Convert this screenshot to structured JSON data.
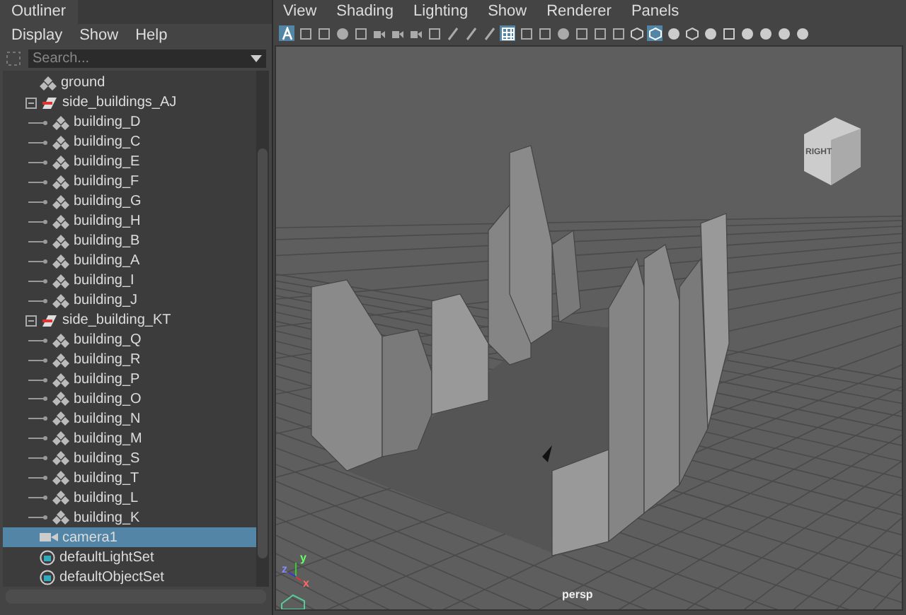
{
  "outliner": {
    "tab": "Outliner",
    "menu": [
      "Display",
      "Show",
      "Help"
    ],
    "search": {
      "placeholder": "Search..."
    },
    "items": [
      {
        "label": "ground",
        "kind": "transform",
        "selected": false
      },
      {
        "label": "side_buildings_AJ",
        "kind": "group",
        "selected": false,
        "expanded": true,
        "children": [
          {
            "label": "building_D",
            "kind": "transform",
            "selected": false
          },
          {
            "label": "building_C",
            "kind": "transform",
            "selected": false
          },
          {
            "label": "building_E",
            "kind": "transform",
            "selected": false
          },
          {
            "label": "building_F",
            "kind": "transform",
            "selected": false
          },
          {
            "label": "building_G",
            "kind": "transform",
            "selected": false
          },
          {
            "label": "building_H",
            "kind": "transform",
            "selected": false
          },
          {
            "label": "building_B",
            "kind": "transform",
            "selected": false
          },
          {
            "label": "building_A",
            "kind": "transform",
            "selected": false
          },
          {
            "label": "building_I",
            "kind": "transform",
            "selected": false
          },
          {
            "label": "building_J",
            "kind": "transform",
            "selected": false
          }
        ]
      },
      {
        "label": "side_building_KT",
        "kind": "group",
        "selected": false,
        "expanded": true,
        "children": [
          {
            "label": "building_Q",
            "kind": "transform",
            "selected": false
          },
          {
            "label": "building_R",
            "kind": "transform",
            "selected": false
          },
          {
            "label": "building_P",
            "kind": "transform",
            "selected": false
          },
          {
            "label": "building_O",
            "kind": "transform",
            "selected": false
          },
          {
            "label": "building_N",
            "kind": "transform",
            "selected": false
          },
          {
            "label": "building_M",
            "kind": "transform",
            "selected": false
          },
          {
            "label": "building_S",
            "kind": "transform",
            "selected": false
          },
          {
            "label": "building_T",
            "kind": "transform",
            "selected": false
          },
          {
            "label": "building_L",
            "kind": "transform",
            "selected": false
          },
          {
            "label": "building_K",
            "kind": "transform",
            "selected": false
          }
        ]
      },
      {
        "label": "camera1",
        "kind": "camera",
        "selected": true
      },
      {
        "label": "defaultLightSet",
        "kind": "set",
        "selected": false
      },
      {
        "label": "defaultObjectSet",
        "kind": "set",
        "selected": false
      }
    ]
  },
  "viewport": {
    "menu": [
      "View",
      "Shading",
      "Lighting",
      "Show",
      "Renderer",
      "Panels"
    ],
    "toolbar": [
      {
        "selected": true
      },
      {
        "selected": false
      },
      {
        "selected": false
      },
      {
        "selected": false
      },
      {
        "selected": false
      },
      {
        "selected": false
      },
      {
        "selected": false
      },
      {
        "selected": false
      },
      {
        "selected": false
      },
      {
        "selected": false
      },
      {
        "selected": false
      },
      {
        "selected": false
      },
      {
        "selected": true
      },
      {
        "selected": false
      },
      {
        "selected": false
      },
      {
        "selected": false
      },
      {
        "selected": false
      },
      {
        "selected": false
      },
      {
        "selected": false
      },
      {
        "selected": false
      },
      {
        "selected": true
      },
      {
        "selected": false
      },
      {
        "selected": false
      },
      {
        "selected": false
      },
      {
        "selected": false
      },
      {
        "selected": false
      },
      {
        "selected": false
      },
      {
        "selected": false
      },
      {
        "selected": false
      }
    ],
    "camera_label": "persp",
    "view_cube": "RIGHT",
    "axes": [
      "y",
      "z",
      "x"
    ]
  }
}
